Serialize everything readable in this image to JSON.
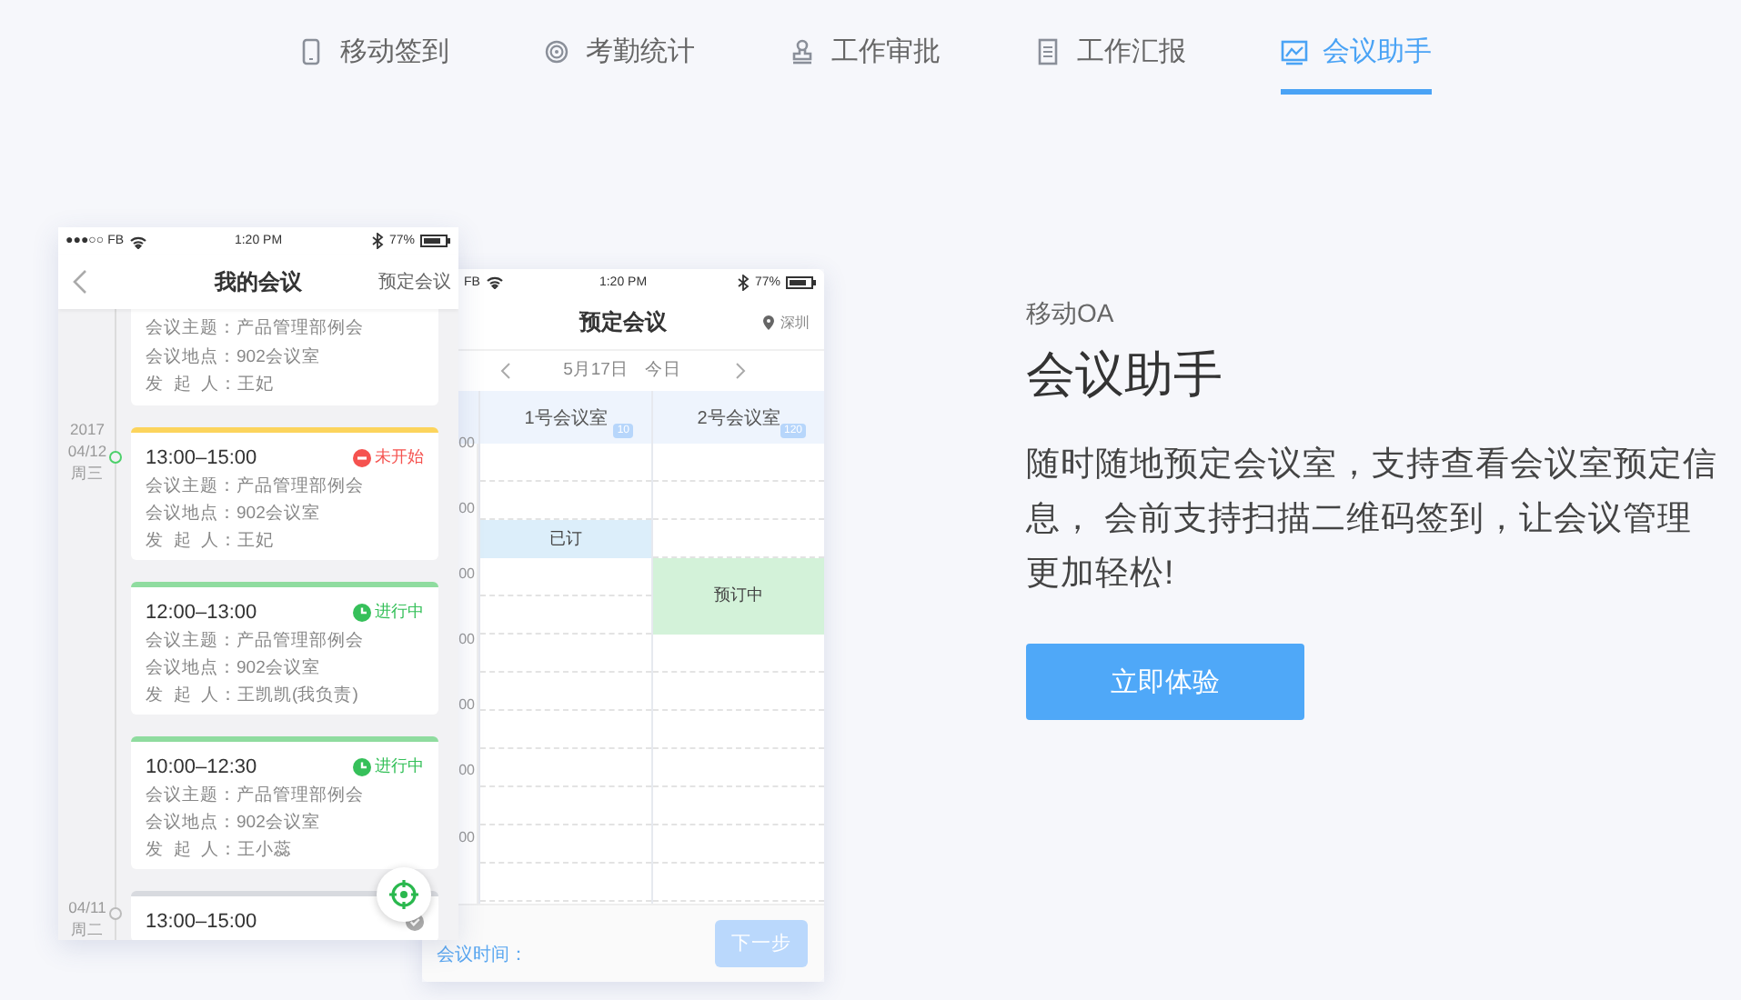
{
  "tabs": [
    {
      "label": "移动签到",
      "selected": false
    },
    {
      "label": "考勤统计",
      "selected": false
    },
    {
      "label": "工作审批",
      "selected": false
    },
    {
      "label": "工作汇报",
      "selected": false
    },
    {
      "label": "会议助手",
      "selected": true
    }
  ],
  "my_meetings_phone": {
    "status_bar": {
      "carrier": "●●●○○ FB",
      "time": "1:20 PM",
      "battery": "77%"
    },
    "title": "我的会议",
    "action": "预定会议",
    "meetings": [
      {
        "lines": [
          "会议主题：产品管理部例会",
          "会议地点：902会议室",
          "发  起  人：王妃"
        ]
      },
      {
        "date": {
          "year": "2017",
          "day": "04/12",
          "weekday": "周三",
          "current": true
        },
        "time": "13:00–15:00",
        "kind": "pending",
        "status": "未开始",
        "lines": [
          "会议主题：产品管理部例会",
          "会议地点：902会议室",
          "发  起  人：王妃"
        ]
      },
      {
        "time": "12:00–13:00",
        "kind": "ongoing",
        "status": "进行中",
        "lines": [
          "会议主题：产品管理部例会",
          "会议地点：902会议室",
          "发  起  人：王凯凯(我负责)"
        ]
      },
      {
        "time": "10:00–12:30",
        "kind": "ongoing",
        "status": "进行中",
        "lines": [
          "会议主题：产品管理部例会",
          "会议地点：902会议室",
          "发  起  人：王小蕊"
        ]
      },
      {
        "date": {
          "day": "04/11",
          "weekday": "周二",
          "current": false
        },
        "time": "13:00–15:00",
        "kind": "done"
      }
    ]
  },
  "booking_phone": {
    "status_bar": {
      "carrier": "FB",
      "time": "1:20 PM",
      "battery": "77%"
    },
    "title": "预定会议",
    "location": "深圳",
    "date": "5月17日",
    "today": "今日",
    "rooms": [
      {
        "name": "1号会议室",
        "capacity": "10"
      },
      {
        "name": "2号会议室",
        "capacity": "120"
      }
    ],
    "time_labels": [
      "00",
      "00",
      "00",
      "00",
      "00",
      "00",
      "00"
    ],
    "bookings": [
      {
        "kind": "booked",
        "text": "已订"
      },
      {
        "kind": "pending",
        "text": "预订中"
      }
    ],
    "footer_label": "会议时间：",
    "next_button": {
      "label": "下一步",
      "disabled": true
    }
  },
  "promo": {
    "eyebrow": "移动OA",
    "title": "会议助手",
    "description": "随时随地预定会议室，支持查看会议室预定信息， 会前支持扫描二维码签到，让会议管理更加轻松!",
    "button": "立即体验"
  }
}
